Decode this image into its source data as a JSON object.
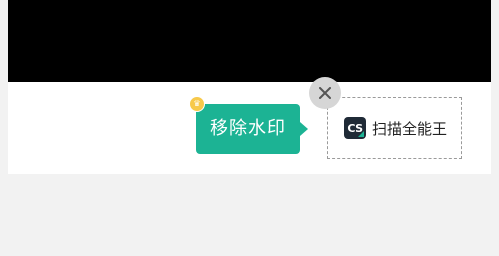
{
  "watermark_toolbar": {
    "remove_label": "移除水印",
    "vip_badge_icon": "crown-icon",
    "close_icon": "close-icon",
    "brand": {
      "logo_text": "CS",
      "name": "扫描全能王"
    }
  },
  "colors": {
    "accent": "#1cb394",
    "badge": "#f7c94b",
    "logo_bg": "#1f2a36"
  }
}
